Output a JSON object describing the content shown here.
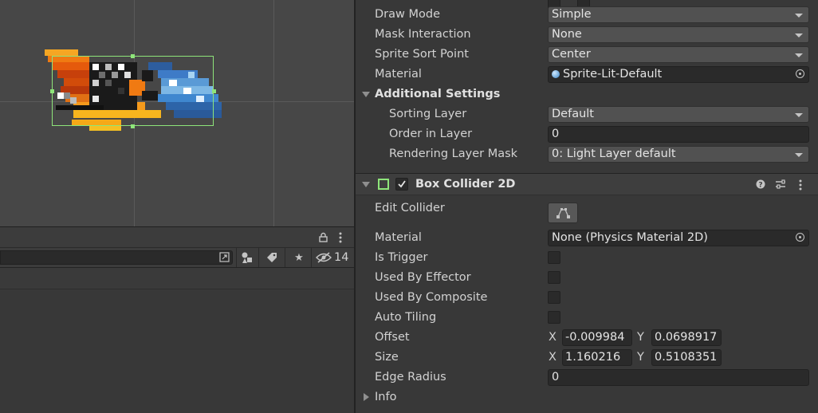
{
  "scene": {
    "accent": "#8ee57a"
  },
  "hierarchy": {
    "lock_icon": "lock-icon",
    "menu_icon": "kebab-menu-icon",
    "hidden_count": "14"
  },
  "inspector": {
    "draw_mode": {
      "label": "Draw Mode",
      "value": "Simple"
    },
    "mask_interaction": {
      "label": "Mask Interaction",
      "value": "None"
    },
    "sprite_sort_point": {
      "label": "Sprite Sort Point",
      "value": "Center"
    },
    "material": {
      "label": "Material",
      "value": "Sprite-Lit-Default"
    },
    "additional_settings": "Additional Settings",
    "sorting_layer": {
      "label": "Sorting Layer",
      "value": "Default"
    },
    "order_in_layer": {
      "label": "Order in Layer",
      "value": "0"
    },
    "rendering_layer_mask": {
      "label": "Rendering Layer Mask",
      "value": "0: Light Layer default"
    },
    "box_collider": {
      "title": "Box Collider 2D",
      "edit_collider": "Edit Collider",
      "material": {
        "label": "Material",
        "value": "None (Physics Material 2D)"
      },
      "is_trigger": "Is Trigger",
      "used_by_effector": "Used By Effector",
      "used_by_composite": "Used By Composite",
      "auto_tiling": "Auto Tiling",
      "offset": {
        "label": "Offset",
        "x_axis": "X",
        "x": "-0.009984",
        "y_axis": "Y",
        "y": "0.0698917"
      },
      "size": {
        "label": "Size",
        "x_axis": "X",
        "x": "1.160216",
        "y_axis": "Y",
        "y": "0.5108351"
      },
      "edge_radius": {
        "label": "Edge Radius",
        "value": "0"
      },
      "info": "Info"
    }
  }
}
